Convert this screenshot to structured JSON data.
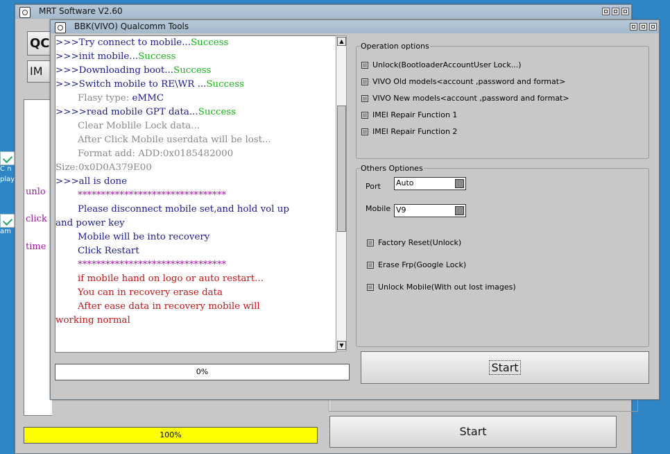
{
  "desktop": {
    "icon_labels": [
      "C n",
      "play",
      "am"
    ]
  },
  "bg_window": {
    "title": "MRT Software V2.60",
    "tab_btn_1": "QC",
    "tab_btn_2": "IM",
    "log_fragments": [
      "unlo",
      "click",
      "time"
    ],
    "progress_value": "100%",
    "progress_fraction": 1.0,
    "progress_color": "#ffff00",
    "start_label": "Start"
  },
  "fg_window": {
    "title": "BBK(VIVO) Qualcomm Tools",
    "log": [
      {
        "parts": [
          {
            "t": ">>>Try connect to mobile...",
            "c": "blue"
          },
          {
            "t": "Success",
            "c": "green"
          }
        ]
      },
      {
        "parts": [
          {
            "t": ">>>init mobile...",
            "c": "blue"
          },
          {
            "t": "Success",
            "c": "green"
          }
        ]
      },
      {
        "parts": [
          {
            "t": ">>>Downloading boot...",
            "c": "blue"
          },
          {
            "t": "Success",
            "c": "green"
          }
        ]
      },
      {
        "parts": [
          {
            "t": ">>>Switch mobile to RE\\WR ...",
            "c": "blue"
          },
          {
            "t": "Success",
            "c": "green"
          }
        ]
      },
      {
        "indent": true,
        "parts": [
          {
            "t": "Flasy type:  ",
            "c": "gray"
          },
          {
            "t": "eMMC",
            "c": "blue"
          }
        ]
      },
      {
        "parts": [
          {
            "t": ">>>>read mobile GPT data...",
            "c": "blue"
          },
          {
            "t": "Success",
            "c": "green"
          }
        ]
      },
      {
        "indent": true,
        "parts": [
          {
            "t": "Clear Moblile Lock data...",
            "c": "gray"
          }
        ]
      },
      {
        "indent": true,
        "parts": [
          {
            "t": "After Click Mobile userdata will be lost...",
            "c": "gray"
          }
        ]
      },
      {
        "indent": true,
        "parts": [
          {
            "t": "Format add: ADD:0x0185482000",
            "c": "gray"
          }
        ]
      },
      {
        "parts": [
          {
            "t": "Size:0x0D0A379E00",
            "c": "gray"
          }
        ]
      },
      {
        "parts": [
          {
            "t": ">>>all is done",
            "c": "blue"
          }
        ]
      },
      {
        "indent": true,
        "parts": [
          {
            "t": "********************************",
            "c": "purple"
          }
        ]
      },
      {
        "indent": true,
        "parts": [
          {
            "t": "Please disconnect mobile set,and hold vol up",
            "c": "blue"
          }
        ]
      },
      {
        "parts": [
          {
            "t": "and power key",
            "c": "blue"
          }
        ]
      },
      {
        "indent": true,
        "parts": [
          {
            "t": "Mobile will be into recovery",
            "c": "blue"
          }
        ]
      },
      {
        "indent": true,
        "parts": [
          {
            "t": "Click Restart",
            "c": "blue"
          }
        ]
      },
      {
        "indent": true,
        "parts": [
          {
            "t": "********************************",
            "c": "purple"
          }
        ]
      },
      {
        "indent": true,
        "parts": [
          {
            "t": "if mobile hand on logo or auto restart...",
            "c": "red"
          }
        ]
      },
      {
        "indent": true,
        "parts": [
          {
            "t": "You can in recovery erase data",
            "c": "red"
          }
        ]
      },
      {
        "indent": true,
        "parts": [
          {
            "t": "After ease data in recovery mobile will",
            "c": "red"
          }
        ]
      },
      {
        "parts": [
          {
            "t": "working normal",
            "c": "red"
          }
        ]
      }
    ],
    "progress_value": "0%",
    "progress_fraction": 0.0,
    "operation_options": {
      "title": "Operation options",
      "items": [
        "Unlock(BootloaderAccountUser Lock...)",
        "VIVO Old models<account ,password and format>",
        "VIVO New models<account ,password and format>",
        "IMEI Repair Function 1",
        "IMEI Repair Function 2"
      ]
    },
    "others_options": {
      "title": "Others Optiones",
      "port_label": "Port",
      "port_value": "Auto",
      "mobile_label": "Mobile",
      "mobile_value": "V9",
      "checks": [
        "Factory Reset(Unlock)",
        "Erase Frp(Google Lock)",
        "Unlock Mobile(With out lost images)"
      ]
    },
    "start_label": "Start"
  },
  "colors": {
    "log_blue": "#1b1b8f",
    "log_green": "#15b515",
    "log_gray": "#8a8a8a",
    "log_red": "#c41616",
    "log_purple": "#a01ca0"
  }
}
